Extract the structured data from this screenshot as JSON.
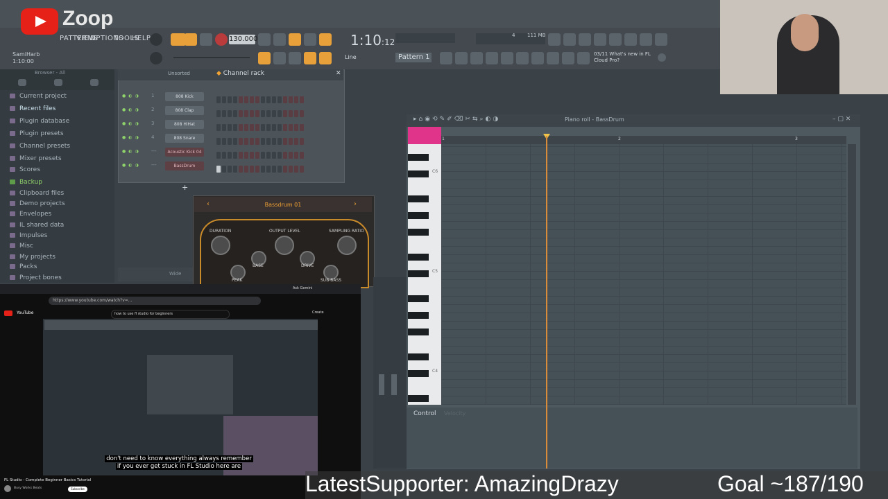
{
  "stream": {
    "brand_name": "Zoop",
    "supporter_banner": "LatestSupporter: AmazingDrazy",
    "goal_banner": "Goal ~187/190"
  },
  "toolbar": {
    "menu_items": [
      "PATTERNS",
      "VIEW",
      "OPTIONS",
      "TOOLS",
      "HELP"
    ],
    "tempo": "130.000",
    "time_display": "1:10",
    "time_ticks": ":12",
    "user_name": "SamiHarb",
    "user_time": "1:10:00",
    "snap_mode": "Line",
    "pattern": "Pattern 1",
    "news_line1": "03/11  What's new in FL",
    "news_line2": "Cloud Pro?",
    "cpu_label": "111 MB",
    "voices": "4"
  },
  "browser": {
    "title": "Browser - All",
    "items": [
      {
        "label": "Current project",
        "style": "normal"
      },
      {
        "label": "Recent files",
        "style": "highlight"
      },
      {
        "label": "Plugin database",
        "style": "normal"
      },
      {
        "label": "Plugin presets",
        "style": "normal"
      },
      {
        "label": "Channel presets",
        "style": "normal"
      },
      {
        "label": "Mixer presets",
        "style": "normal"
      },
      {
        "label": "Scores",
        "style": "normal"
      },
      {
        "label": "Backup",
        "style": "green"
      },
      {
        "label": "Clipboard files",
        "style": "normal"
      },
      {
        "label": "Demo projects",
        "style": "normal"
      },
      {
        "label": "Envelopes",
        "style": "normal"
      },
      {
        "label": "IL shared data",
        "style": "normal"
      },
      {
        "label": "Impulses",
        "style": "normal"
      },
      {
        "label": "Misc",
        "style": "normal"
      },
      {
        "label": "My projects",
        "style": "normal"
      },
      {
        "label": "Packs",
        "style": "normal"
      },
      {
        "label": "Project bones",
        "style": "normal"
      }
    ]
  },
  "channel_rack": {
    "title": "Channel rack",
    "filter": "Unsorted",
    "channels": [
      {
        "num": "1",
        "name": "808 Kick",
        "selected": false
      },
      {
        "num": "2",
        "name": "808 Clap",
        "selected": false
      },
      {
        "num": "3",
        "name": "808 HiHat",
        "selected": false
      },
      {
        "num": "4",
        "name": "808 Snare",
        "selected": false
      },
      {
        "num": "---",
        "name": "Acoustic Kick 04",
        "selected": true
      },
      {
        "num": "---",
        "name": "BassDrum",
        "selected": true
      }
    ],
    "add_button": "+"
  },
  "plugin": {
    "preset_name": "Bassdrum 01",
    "knobs": [
      "DURATION",
      "OUTPUT LEVEL",
      "SAMPLING RATIO",
      "BASE",
      "DRIVE",
      "PEAK",
      "SUB-BASS"
    ],
    "footer": "Wide"
  },
  "piano_roll": {
    "title": "Piano roll - BassDrum",
    "bar_markers": [
      "1",
      "2",
      "3"
    ],
    "octave_labels": [
      "C6",
      "C5",
      "C4"
    ],
    "control_label": "Control",
    "control_param": "Velocity"
  },
  "youtube": {
    "url": "https://www.youtube.com/watch?v=...",
    "search_query": "how to use fl studio for beginners",
    "logo_label": "YouTube",
    "ask_label": "Ask Gemini",
    "create_label": "Create",
    "subtitle_line1": "don't need to know everything always remember",
    "subtitle_line2": "if you ever get stuck in FL Studio here are",
    "video_title": "FL Studio - Complete Beginner Basics Tutorial",
    "channel": "Busy Works Beats",
    "subscribe_label": "Subscribe"
  },
  "colors": {
    "accent_orange": "#d98d3a",
    "pink_note": "#e0338a",
    "youtube_red": "#e62117"
  }
}
